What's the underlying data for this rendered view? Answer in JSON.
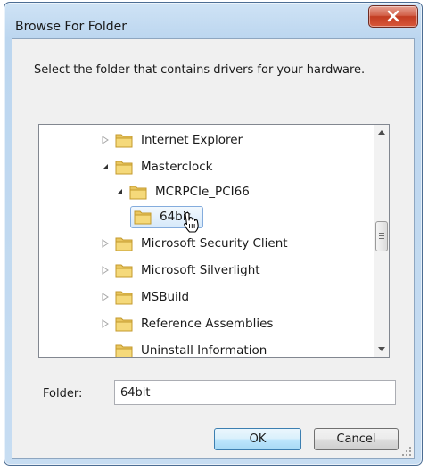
{
  "window": {
    "title": "Browse For Folder",
    "close_glyph": "X"
  },
  "instruction": "Select the folder that contains drivers for your hardware.",
  "tree": {
    "items": [
      {
        "label": "Internet Explorer",
        "expander": "collapsed",
        "selected": false
      },
      {
        "label": "Masterclock",
        "expander": "expanded",
        "selected": false
      },
      {
        "label": "MCRPCIe_PCI66",
        "expander": "expanded",
        "selected": false
      },
      {
        "label": "64bit",
        "expander": "none",
        "selected": true
      },
      {
        "label": "Microsoft Security Client",
        "expander": "collapsed",
        "selected": false
      },
      {
        "label": "Microsoft Silverlight",
        "expander": "collapsed",
        "selected": false
      },
      {
        "label": "MSBuild",
        "expander": "collapsed",
        "selected": false
      },
      {
        "label": "Reference Assemblies",
        "expander": "collapsed",
        "selected": false
      },
      {
        "label": "Uninstall Information",
        "expander": "none",
        "selected": false
      }
    ]
  },
  "folder_field": {
    "label": "Folder:",
    "value": "64bit"
  },
  "buttons": {
    "ok": "OK",
    "cancel": "Cancel"
  },
  "icons": [
    "close-icon",
    "folder-icon",
    "expand-triangle-icon",
    "collapse-triangle-icon",
    "scroll-up-icon",
    "scroll-down-icon",
    "hand-cursor-icon",
    "resize-grip-icon"
  ],
  "colors": {
    "title_bar": "#bcd6ef",
    "close_button": "#c23c22",
    "folder": "#e9c65f",
    "selection": "#d6e9fa"
  }
}
